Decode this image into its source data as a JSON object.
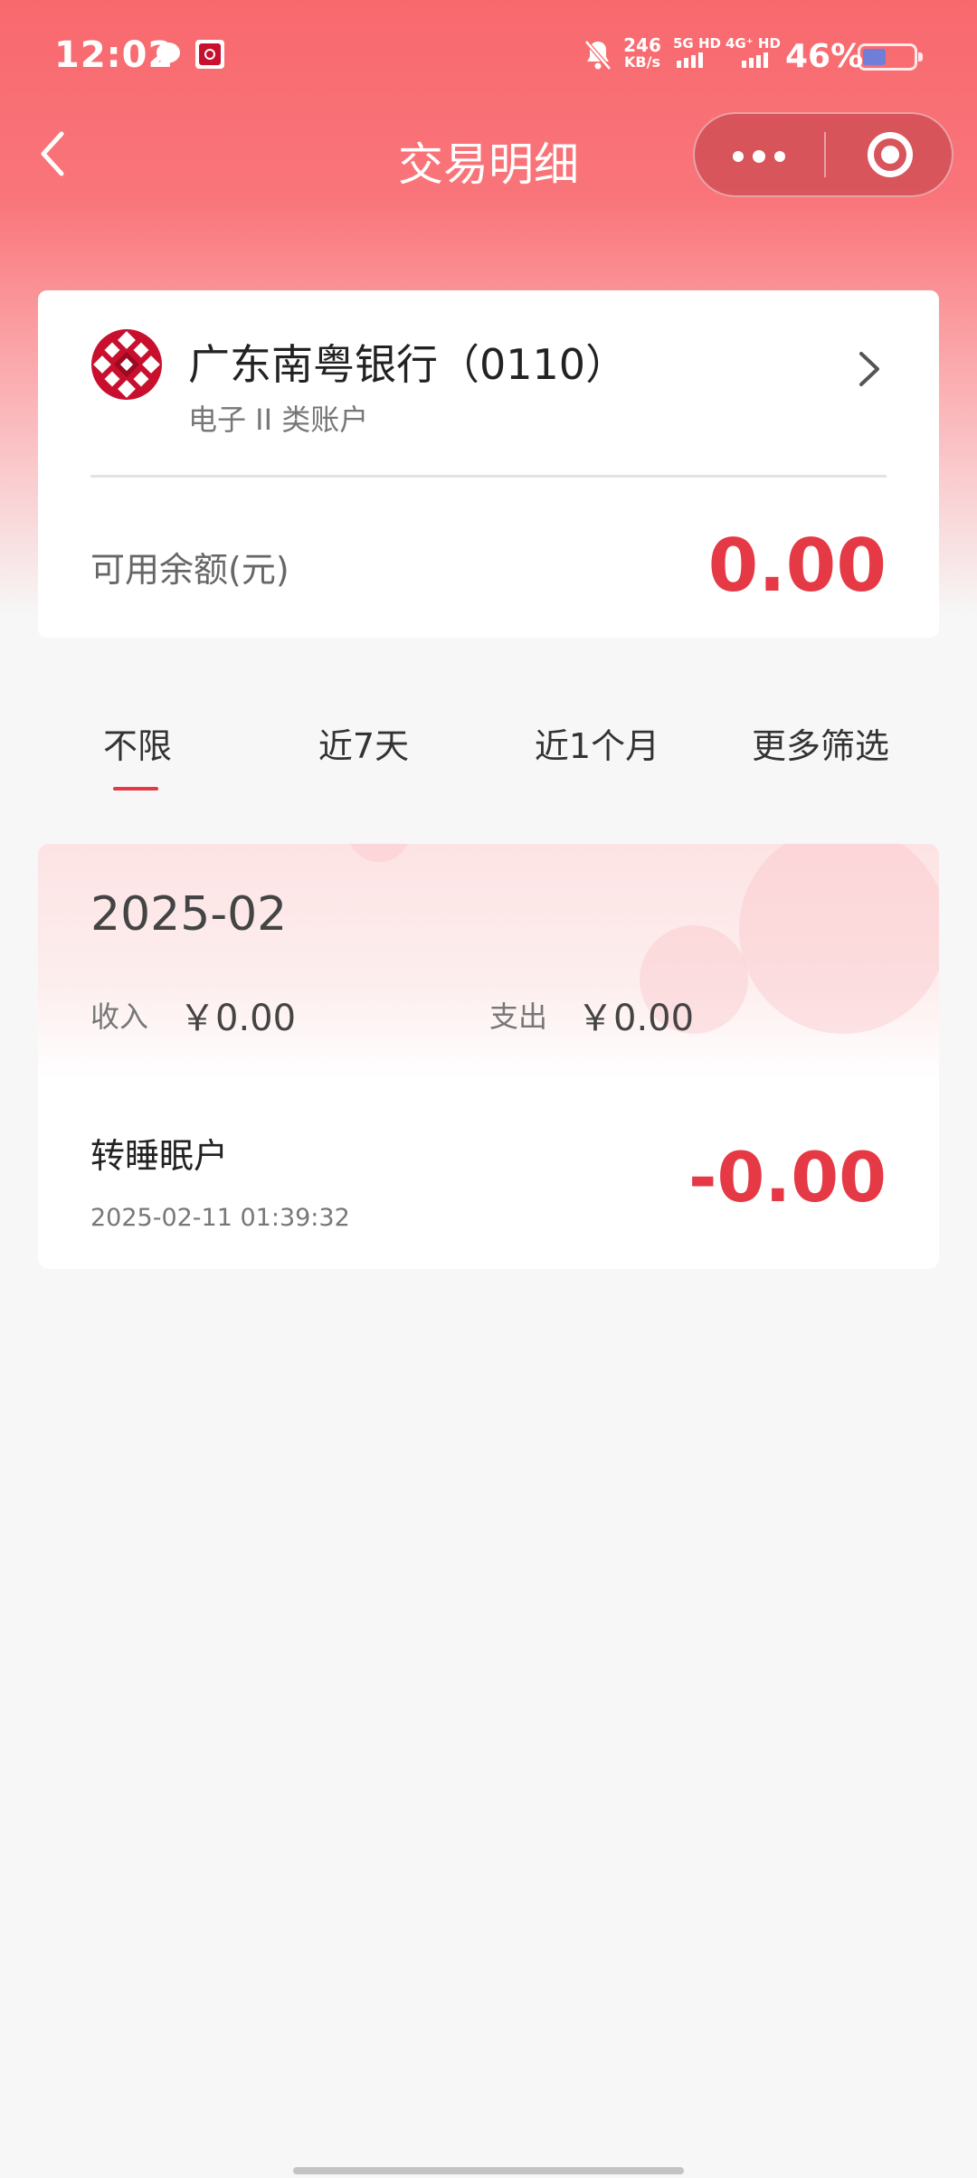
{
  "status_bar": {
    "time": "12:02",
    "speed_value": "246",
    "speed_unit": "KB/s",
    "net1": "5G HD",
    "net2": "4G⁺ HD",
    "battery": "46%",
    "battery_level": 0.46
  },
  "nav": {
    "title": "交易明细"
  },
  "account": {
    "bank_name": "广东南粤银行（0110）",
    "account_type": "电子 II 类账户",
    "balance_label": "可用余额(元)",
    "balance": "0.00"
  },
  "tabs": [
    {
      "label": "不限",
      "active": true
    },
    {
      "label": "近7天",
      "active": false
    },
    {
      "label": "近1个月",
      "active": false
    },
    {
      "label": "更多筛选",
      "active": false
    }
  ],
  "transactions": {
    "month": "2025-02",
    "income_label": "收入",
    "income_value": "￥0.00",
    "expense_label": "支出",
    "expense_value": "￥0.00",
    "items": [
      {
        "title": "转睡眠户",
        "time": "2025-02-11 01:39:32",
        "amount": "-0.00"
      }
    ]
  },
  "colors": {
    "accent": "#e53945",
    "header": "#f8696e"
  }
}
